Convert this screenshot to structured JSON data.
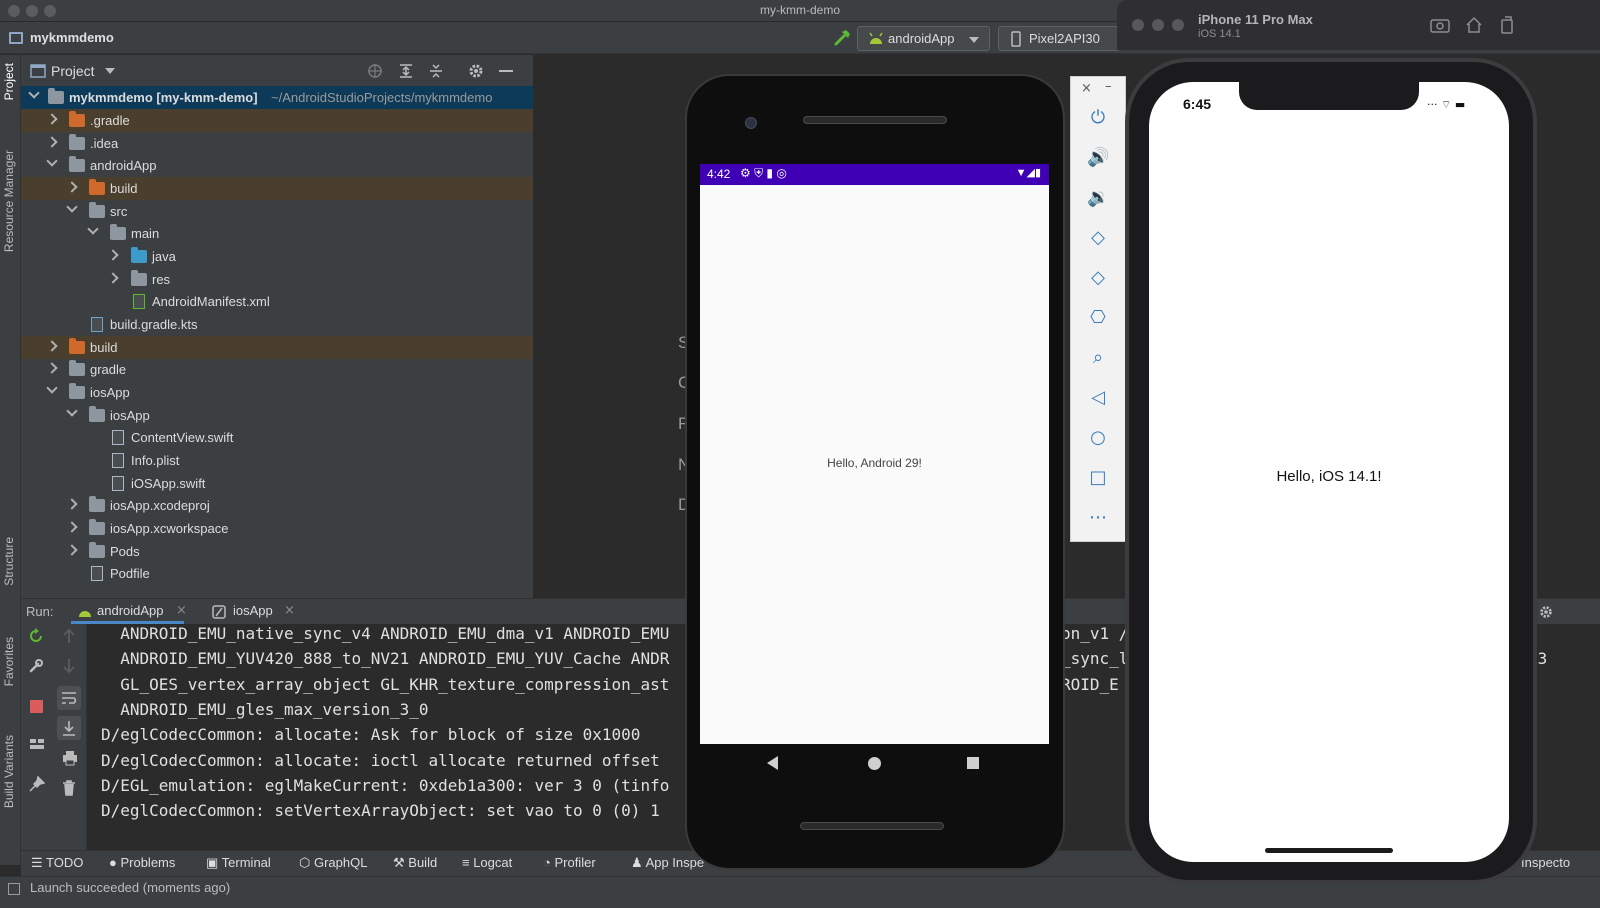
{
  "window": {
    "title": "my-kmm-demo"
  },
  "navbar": {
    "project_name": "mykmmdemo",
    "run_config": "androidApp",
    "device": "Pixel2API30"
  },
  "left_strip": {
    "tabs": [
      "Project",
      "Resource Manager",
      "Structure",
      "Favorites",
      "Build Variants"
    ]
  },
  "project_panel": {
    "title": "Project",
    "tree": [
      {
        "label": "mykmmdemo [my-kmm-demo]",
        "path": "~/AndroidStudioProjects/mykmmdemo"
      },
      {
        "label": ".gradle"
      },
      {
        "label": ".idea"
      },
      {
        "label": "androidApp"
      },
      {
        "label": "build"
      },
      {
        "label": "src"
      },
      {
        "label": "main"
      },
      {
        "label": "java"
      },
      {
        "label": "res"
      },
      {
        "label": "AndroidManifest.xml"
      },
      {
        "label": "build.gradle.kts"
      },
      {
        "label": "build"
      },
      {
        "label": "gradle"
      },
      {
        "label": "iosApp"
      },
      {
        "label": "iosApp"
      },
      {
        "label": "ContentView.swift"
      },
      {
        "label": "Info.plist"
      },
      {
        "label": "iOSApp.swift"
      },
      {
        "label": "iosApp.xcodeproj"
      },
      {
        "label": "iosApp.xcworkspace"
      },
      {
        "label": "Pods"
      },
      {
        "label": "Podfile"
      }
    ]
  },
  "editor": {
    "hint_letters": [
      "S",
      "G",
      "R",
      "N",
      "D"
    ]
  },
  "run_panel": {
    "label": "Run:",
    "tabs": [
      "androidApp",
      "iosApp"
    ],
    "log": [
      "  ANDROID_EMU_native_sync_v4 ANDROID_EMU_dma_v1 ANDROID_EMU",
      "  ANDROID_EMU_YUV420_888_to_NV21 ANDROID_EMU_YUV_Cache ANDR",
      "  GL_OES_vertex_array_object GL_KHR_texture_compression_ast",
      "  ANDROID_EMU_gles_max_version_3_0",
      "D/eglCodecCommon: allocate: Ask for block of size 0x1000",
      "D/eglCodecCommon: allocate: ioctl allocate returned offset",
      "D/EGL_emulation: eglMakeCurrent: 0xdeb1a300: ver 3 0 (tinfo",
      "D/eglCodecCommon: setVertexArrayObject: set vao to 0 (0) 1"
    ],
    "log_tails": [
      "on_v1 /",
      "_sync_l",
      "ROID_E"
    ],
    "log_tail_extra": "l3"
  },
  "bottom_toolbar": {
    "items": [
      "TODO",
      "Problems",
      "Terminal",
      "GraphQL",
      "Build",
      "Logcat",
      "Profiler",
      "App Inspe"
    ],
    "right": "Inspecto"
  },
  "status": {
    "text": "Launch succeeded (moments ago)"
  },
  "android": {
    "time": "4:42",
    "hello": "Hello, Android 29!"
  },
  "ios": {
    "device_name": "iPhone 11 Pro Max",
    "os": "iOS 14.1",
    "time": "6:45",
    "hello": "Hello, iOS 14.1!"
  },
  "colors": {
    "android_status": "#3f00b5",
    "selection": "#0d3a58",
    "excluded": "#4a3f2c",
    "accent": "#4a88c7"
  }
}
